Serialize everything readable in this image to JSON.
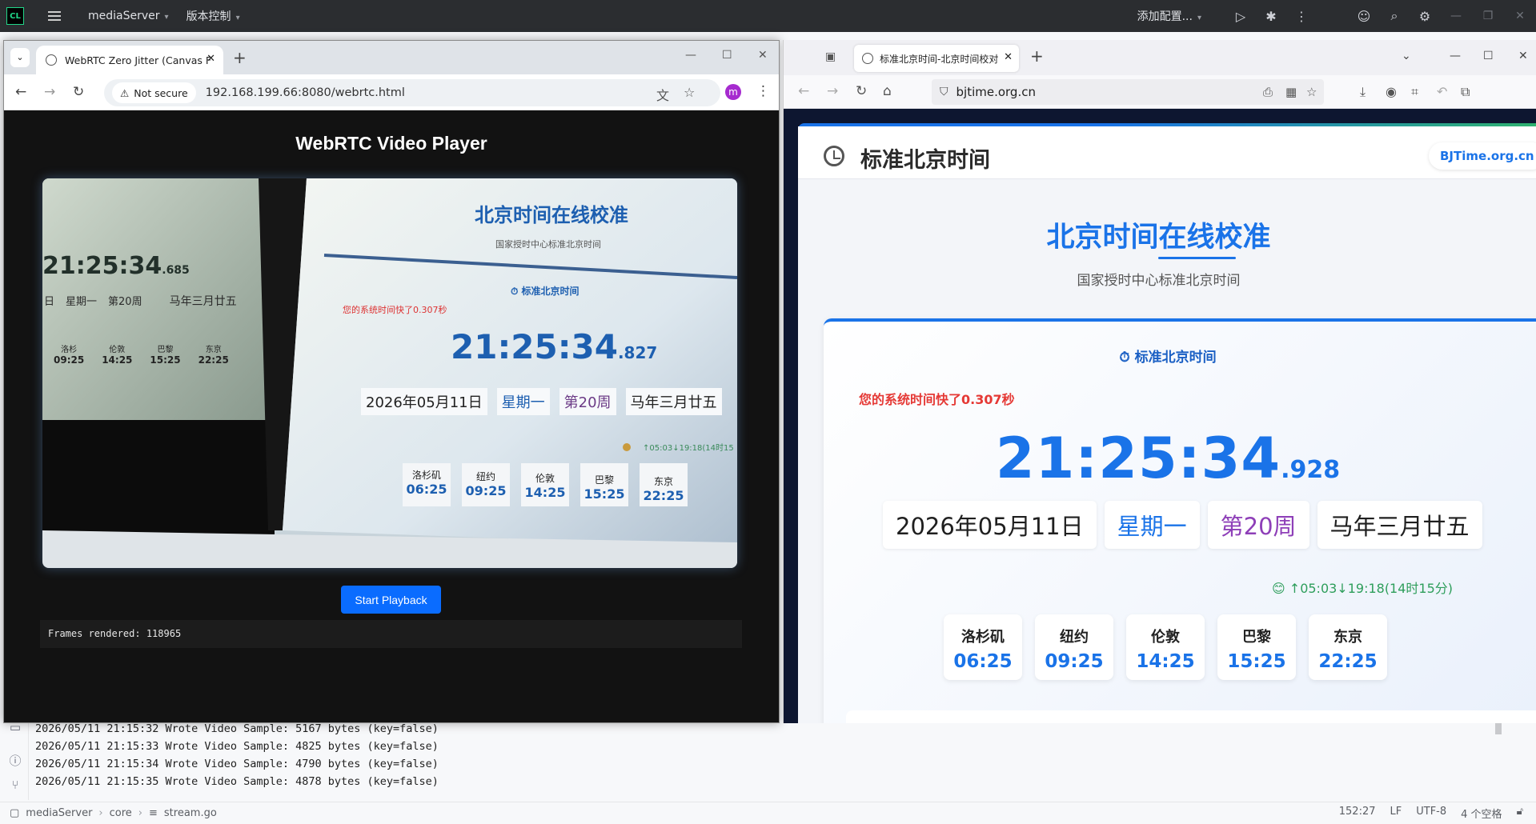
{
  "ide": {
    "logo": "CL",
    "project": "mediaServer",
    "vcs": "版本控制",
    "run_config": "添加配置...",
    "icons": [
      "run-icon",
      "debug-icon",
      "more-icon",
      "add-user-icon",
      "search-icon",
      "settings-icon"
    ]
  },
  "console": {
    "lines": [
      "2026/05/11 21:15:32 Wrote Video Sample: 5167 bytes (key=false)",
      "2026/05/11 21:15:33 Wrote Video Sample: 4825 bytes (key=false)",
      "2026/05/11 21:15:34 Wrote Video Sample: 4790 bytes (key=false)",
      "2026/05/11 21:15:35 Wrote Video Sample: 4878 bytes (key=false)"
    ]
  },
  "status": {
    "project": "mediaServer",
    "folder": "core",
    "file": "stream.go",
    "position": "152:27",
    "line_ending": "LF",
    "encoding": "UTF-8",
    "indent": "4 个空格"
  },
  "chrome": {
    "tab_title": "WebRTC Zero Jitter (Canvas F",
    "security": "Not secure",
    "url": "192.168.199.66:8080/webrtc.html",
    "profile_initial": "m",
    "page": {
      "title": "WebRTC Video Player",
      "button": "Start Playback",
      "frames": "Frames rendered: 118965"
    },
    "video": {
      "small_time": "21:25:34",
      "small_ms": ".685",
      "small_labels": [
        "日",
        "星期一",
        "第20周",
        "马年三月廿五"
      ],
      "small_cities": [
        {
          "name": "洛杉",
          "time": "09:25"
        },
        {
          "name": "伦敦",
          "time": "14:25"
        },
        {
          "name": "巴黎",
          "time": "15:25"
        },
        {
          "name": "东京",
          "time": "22:25"
        }
      ],
      "title": "北京时间在线校准",
      "subtitle": "国家授时中心标准北京时间",
      "card_title": "标准北京时间",
      "diff": "您的系统时间快了0.307秒",
      "time": "21:25:34",
      "ms": ".827",
      "chips": [
        "2026年05月11日",
        "星期一",
        "第20周",
        "马年三月廿五"
      ],
      "sun": "↑05:03↓19:18(14时15",
      "cities": [
        {
          "name": "洛杉矶",
          "time": "06:25"
        },
        {
          "name": "纽约",
          "time": "09:25"
        },
        {
          "name": "伦敦",
          "time": "14:25"
        },
        {
          "name": "巴黎",
          "time": "15:25"
        },
        {
          "name": "东京",
          "time": "22:25"
        }
      ]
    }
  },
  "firefox": {
    "tab_title": "标准北京时间-北京时间校对",
    "url": "bjtime.org.cn",
    "page": {
      "header_title": "标准北京时间",
      "brand": "BJTime.org.cn",
      "title": "北京时间在线校准",
      "subtitle": "国家授时中心标准北京时间",
      "card_title": "标准北京时间",
      "diff": "您的系统时间快了0.307秒",
      "time": "21:25:34",
      "ms": ".928",
      "date": "2026年05月11日",
      "weekday": "星期一",
      "week": "第20周",
      "lunar": "马年三月廿五",
      "sun": "↑05:03↓19:18(14时15分)",
      "cities": [
        {
          "name": "洛杉矶",
          "time": "06:25"
        },
        {
          "name": "纽约",
          "time": "09:25"
        },
        {
          "name": "伦敦",
          "time": "14:25"
        },
        {
          "name": "巴黎",
          "time": "15:25"
        },
        {
          "name": "东京",
          "time": "22:25"
        }
      ]
    }
  },
  "colors": {
    "accent_blue": "#1a73e8",
    "alert_red": "#e53935",
    "sun_green": "#2e9e5b",
    "weekday_blue": "#1a73e8",
    "week_purple": "#8e3fb8",
    "button_blue": "#0a6cff"
  }
}
